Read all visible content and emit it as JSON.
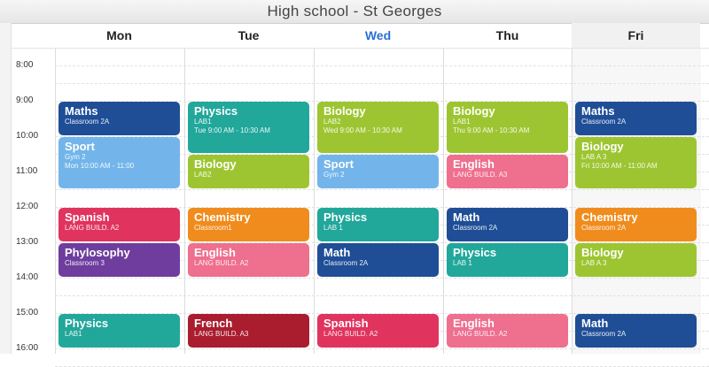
{
  "window": {
    "title": "High school  -  St Georges"
  },
  "days": [
    {
      "label": "Mon",
      "today": false
    },
    {
      "label": "Tue",
      "today": false
    },
    {
      "label": "Wed",
      "today": true
    },
    {
      "label": "Thu",
      "today": false
    },
    {
      "label": "Fri",
      "today": false
    }
  ],
  "times": [
    "8:00",
    "9:00",
    "10:00",
    "11:00",
    "12:00",
    "13:00",
    "14:00",
    "15:00",
    "16:00"
  ],
  "colors": {
    "navy": "#1f4e97",
    "sky": "#73b5ea",
    "red": "#e0335e",
    "purple": "#6e3d9e",
    "teal": "#22a79b",
    "lime": "#9dc531",
    "orange": "#f08c1d",
    "pink": "#ee6f8e",
    "darkred": "#a91d2f",
    "today": "#2a6ed6"
  },
  "events": [
    {
      "day": 0,
      "start": 9.0,
      "end": 10.0,
      "title": "Maths",
      "subtitle": "Classroom 2A",
      "color": "navy"
    },
    {
      "day": 0,
      "start": 10.0,
      "end": 11.5,
      "title": "Sport",
      "subtitle": "Gym 2",
      "subtitle2": "Mon 10:00 AM - 11:00",
      "color": "sky"
    },
    {
      "day": 0,
      "start": 12.0,
      "end": 13.0,
      "title": "Spanish",
      "subtitle": "LANG BUILD. A2",
      "color": "red"
    },
    {
      "day": 0,
      "start": 13.0,
      "end": 14.0,
      "title": "Phylosophy",
      "subtitle": "Classroom 3",
      "color": "purple"
    },
    {
      "day": 0,
      "start": 15.0,
      "end": 16.0,
      "title": "Physics",
      "subtitle": "LAB1",
      "color": "teal"
    },
    {
      "day": 1,
      "start": 9.0,
      "end": 10.5,
      "title": "Physics",
      "subtitle": "LAB1",
      "subtitle2": "Tue 9:00 AM - 10:30 AM",
      "color": "teal"
    },
    {
      "day": 1,
      "start": 10.5,
      "end": 11.5,
      "title": "Biology",
      "subtitle": "LAB2",
      "color": "lime"
    },
    {
      "day": 1,
      "start": 12.0,
      "end": 13.0,
      "title": "Chemistry",
      "subtitle": "Classroom1",
      "color": "orange"
    },
    {
      "day": 1,
      "start": 13.0,
      "end": 14.0,
      "title": "English",
      "subtitle": "LANG BUILD. A2",
      "color": "pink"
    },
    {
      "day": 1,
      "start": 15.0,
      "end": 16.0,
      "title": "French",
      "subtitle": "LANG BUILD. A3",
      "color": "darkred"
    },
    {
      "day": 2,
      "start": 9.0,
      "end": 10.5,
      "title": "Biology",
      "subtitle": "LAB2",
      "subtitle2": "Wed 9:00 AM - 10:30 AM",
      "color": "lime"
    },
    {
      "day": 2,
      "start": 10.5,
      "end": 11.5,
      "title": "Sport",
      "subtitle": "Gym 2",
      "color": "sky"
    },
    {
      "day": 2,
      "start": 12.0,
      "end": 13.0,
      "title": "Physics",
      "subtitle": "LAB 1",
      "color": "teal"
    },
    {
      "day": 2,
      "start": 13.0,
      "end": 14.0,
      "title": "Math",
      "subtitle": "Classroom 2A",
      "color": "navy"
    },
    {
      "day": 2,
      "start": 15.0,
      "end": 16.0,
      "title": "Spanish",
      "subtitle": "LANG BUILD. A2",
      "color": "red"
    },
    {
      "day": 3,
      "start": 9.0,
      "end": 10.5,
      "title": "Biology",
      "subtitle": "LAB1",
      "subtitle2": "Thu 9:00 AM - 10:30 AM",
      "color": "lime"
    },
    {
      "day": 3,
      "start": 10.5,
      "end": 11.5,
      "title": "English",
      "subtitle": "LANG BUILD. A3",
      "color": "pink"
    },
    {
      "day": 3,
      "start": 12.0,
      "end": 13.0,
      "title": "Math",
      "subtitle": "Classroom 2A",
      "color": "navy"
    },
    {
      "day": 3,
      "start": 13.0,
      "end": 14.0,
      "title": "Physics",
      "subtitle": "LAB 1",
      "color": "teal"
    },
    {
      "day": 3,
      "start": 15.0,
      "end": 16.0,
      "title": "English",
      "subtitle": "LANG BUILD. A2",
      "color": "pink"
    },
    {
      "day": 4,
      "start": 9.0,
      "end": 10.0,
      "title": "Maths",
      "subtitle": "Classroom 2A",
      "color": "navy"
    },
    {
      "day": 4,
      "start": 10.0,
      "end": 11.5,
      "title": "Biology",
      "subtitle": "LAB A 3",
      "subtitle2": "Fri 10:00 AM - 11:00 AM",
      "color": "lime"
    },
    {
      "day": 4,
      "start": 12.0,
      "end": 13.0,
      "title": "Chemistry",
      "subtitle": "Classroom 2A",
      "color": "orange"
    },
    {
      "day": 4,
      "start": 13.0,
      "end": 14.0,
      "title": "Biology",
      "subtitle": "LAB A 3",
      "color": "lime"
    },
    {
      "day": 4,
      "start": 15.0,
      "end": 16.0,
      "title": "Math",
      "subtitle": "Classroom 2A",
      "color": "navy"
    }
  ]
}
